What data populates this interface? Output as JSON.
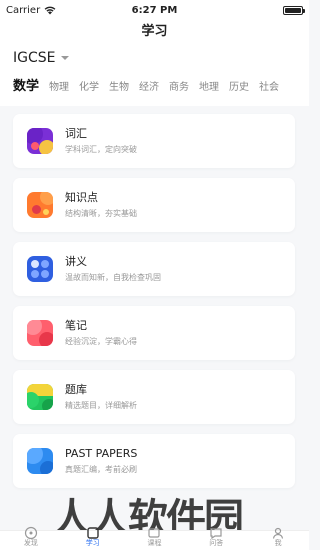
{
  "status_bar": {
    "carrier": "Carrier",
    "time": "6:27 PM"
  },
  "header": {
    "title": "学习"
  },
  "exam_selector": {
    "label": "IGCSE"
  },
  "subject_tabs": [
    {
      "label": "数学",
      "active": true
    },
    {
      "label": "物理"
    },
    {
      "label": "化学"
    },
    {
      "label": "生物"
    },
    {
      "label": "经济"
    },
    {
      "label": "商务"
    },
    {
      "label": "地理"
    },
    {
      "label": "历史"
    },
    {
      "label": "社会"
    }
  ],
  "cards": [
    {
      "title": "词汇",
      "subtitle": "学科词汇，定向突破",
      "icon": "vocabulary-icon"
    },
    {
      "title": "知识点",
      "subtitle": "结构清晰，夯实基础",
      "icon": "knowledge-icon"
    },
    {
      "title": "讲义",
      "subtitle": "温故而知新，自我检查巩固",
      "icon": "handout-icon"
    },
    {
      "title": "笔记",
      "subtitle": "经验沉淀，学霸心得",
      "icon": "notes-icon"
    },
    {
      "title": "题库",
      "subtitle": "精选题目，详细解析",
      "icon": "question-bank-icon"
    },
    {
      "title": "PAST PAPERS",
      "subtitle": "真题汇编，考前必刷",
      "icon": "past-papers-icon"
    }
  ],
  "tabbar": [
    {
      "label": "发现"
    },
    {
      "label": "学习",
      "active": true
    },
    {
      "label": "课程"
    },
    {
      "label": "问答"
    },
    {
      "label": "我"
    }
  ],
  "watermark": "人人软件园",
  "colors": {
    "accent": "#2a6ff0"
  }
}
